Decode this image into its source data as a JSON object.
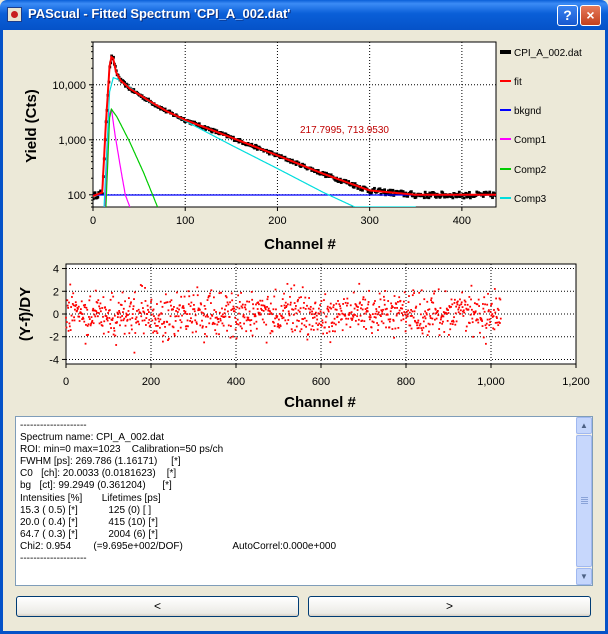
{
  "window": {
    "title": "PAScual - Fitted Spectrum 'CPI_A_002.dat'",
    "help_glyph": "?",
    "close_glyph": "×",
    "colors": {
      "titlebar": "#0a5fd8",
      "client": "#ece9d8"
    }
  },
  "chart_data": [
    {
      "type": "line",
      "xlabel": "Channel #",
      "ylabel": "Yield (Cts)",
      "yscale": "log",
      "xlim": [
        0,
        437
      ],
      "ylim": [
        60,
        60000
      ],
      "x_ticks": [
        "0",
        "100",
        "200",
        "300",
        "400"
      ],
      "y_ticks": [
        "100",
        "1,000",
        "10,000"
      ],
      "grid": true,
      "legend_position": "right",
      "annotation": "217.7995, 713.9530",
      "series": [
        {
          "name": "CPI_A_002.dat",
          "color": "#000000",
          "style": "data points",
          "x": [
            0,
            10,
            14,
            18,
            20,
            22,
            25,
            30,
            40,
            60,
            80,
            100,
            150,
            200,
            250,
            300,
            350,
            400,
            437
          ],
          "y": [
            95,
            110,
            2000,
            22000,
            32000,
            30000,
            17000,
            12000,
            8500,
            5200,
            3300,
            2300,
            1100,
            520,
            240,
            120,
            100,
            100,
            100
          ]
        },
        {
          "name": "fit",
          "color": "#ff0000",
          "style": "line",
          "x": [
            0,
            10,
            14,
            18,
            20,
            22,
            25,
            30,
            40,
            60,
            80,
            100,
            150,
            200,
            250,
            300,
            350,
            400,
            437
          ],
          "y": [
            95,
            110,
            2000,
            22000,
            32000,
            30000,
            17000,
            12000,
            8500,
            5200,
            3300,
            2300,
            1100,
            520,
            240,
            120,
            100,
            100,
            100
          ]
        },
        {
          "name": "bkgnd",
          "color": "#0000ff",
          "style": "line",
          "x": [
            0,
            437
          ],
          "y": [
            99.3,
            99.3
          ]
        },
        {
          "name": "Comp1",
          "color": "#ff00ff",
          "style": "line",
          "x": [
            13,
            18,
            20,
            24,
            30,
            35,
            40
          ],
          "y": [
            60,
            3000,
            3600,
            1200,
            300,
            100,
            60
          ]
        },
        {
          "name": "Comp2",
          "color": "#00cc00",
          "style": "line",
          "x": [
            14,
            18,
            20,
            26,
            40,
            55,
            70
          ],
          "y": [
            60,
            2500,
            3600,
            2600,
            900,
            250,
            60
          ]
        },
        {
          "name": "Comp3",
          "color": "#00dddd",
          "style": "line",
          "x": [
            12,
            18,
            22,
            30,
            60,
            100,
            150,
            200,
            250,
            300,
            350
          ],
          "y": [
            60,
            7500,
            13500,
            12000,
            5000,
            2200,
            800,
            300,
            110,
            45,
            20
          ]
        }
      ]
    },
    {
      "type": "scatter",
      "xlabel": "Channel #",
      "ylabel": "(Y-f)/DY",
      "xlim": [
        0,
        1200
      ],
      "ylim": [
        -4.4,
        4.4
      ],
      "x_ticks": [
        "0",
        "200",
        "400",
        "600",
        "800",
        "1,000",
        "1,200"
      ],
      "y_ticks": [
        "-4",
        "-2",
        "0",
        "2",
        "4"
      ],
      "grid": true,
      "points_x_range": [
        0,
        1023
      ],
      "spread_sd": 0.95,
      "series": [
        {
          "color": "#ff0000"
        }
      ]
    }
  ],
  "fit_report": {
    "lines": [
      "--------------------",
      "Spectrum name: CPI_A_002.dat",
      "ROI: min=0 max=1023    Calibration=50 ps/ch",
      "FWHM [ps]: 269.786 (1.16171)     [*]",
      "C0   [ch]: 20.0033 (0.0181623)    [*]",
      "bg   [ct]: 99.2949 (0.361204)      [*]",
      "Intensities [%]       Lifetimes [ps]",
      "15.3 ( 0.5) [*]           125 (0) [ ]",
      "20.0 ( 0.4) [*]           415 (10) [*]",
      "64.7 ( 0.3) [*]           2004 (6) [*]",
      "Chi2: 0.954        (=9.695e+002/DOF)                  AutoCorrel:0.000e+000",
      "--------------------"
    ],
    "scroll_up_glyph": "▲",
    "scroll_down_glyph": "▼"
  },
  "nav": {
    "prev_label": "<",
    "next_label": ">"
  }
}
